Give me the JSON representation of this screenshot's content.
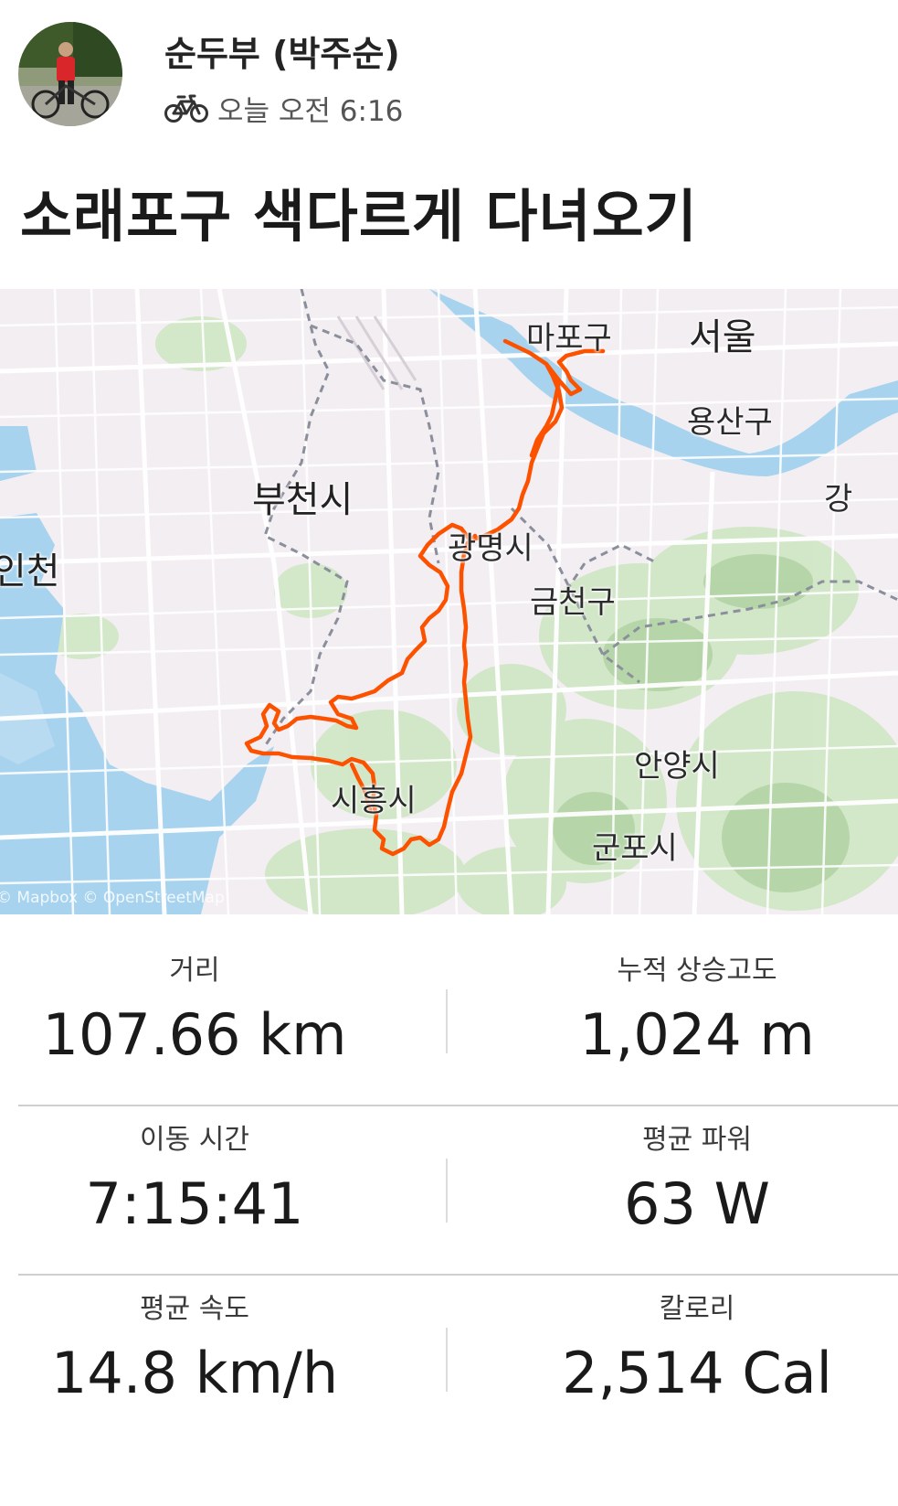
{
  "activity": {
    "athlete_name": "순두부 (박주순)",
    "sport_icon": "bicycle-icon",
    "timestamp": "오늘 오전 6:16",
    "title": "소래포구 색다르게 다녀오기"
  },
  "map": {
    "labels": {
      "mapo": "마포구",
      "seoul": "서울",
      "yongsan": "용산구",
      "bucheon": "부천시",
      "gwangmyeong": "광명시",
      "geumcheon": "금천구",
      "incheon": "인천",
      "gang": "강",
      "anyang": "안양시",
      "siheung": "시흥시",
      "gunpo": "군포시"
    },
    "attribution": "© Mapbox © OpenStreetMap",
    "route_color": "#fc5200"
  },
  "stats": {
    "distance": {
      "label": "거리",
      "value": "107.66 km"
    },
    "elevation": {
      "label": "누적 상승고도",
      "value": "1,024 m"
    },
    "moving_time": {
      "label": "이동 시간",
      "value": "7:15:41"
    },
    "avg_power": {
      "label": "평균 파워",
      "value": "63 W"
    },
    "avg_speed": {
      "label": "평균 속도",
      "value": "14.8 km/h"
    },
    "calories": {
      "label": "칼로리",
      "value": "2,514 Cal"
    }
  }
}
